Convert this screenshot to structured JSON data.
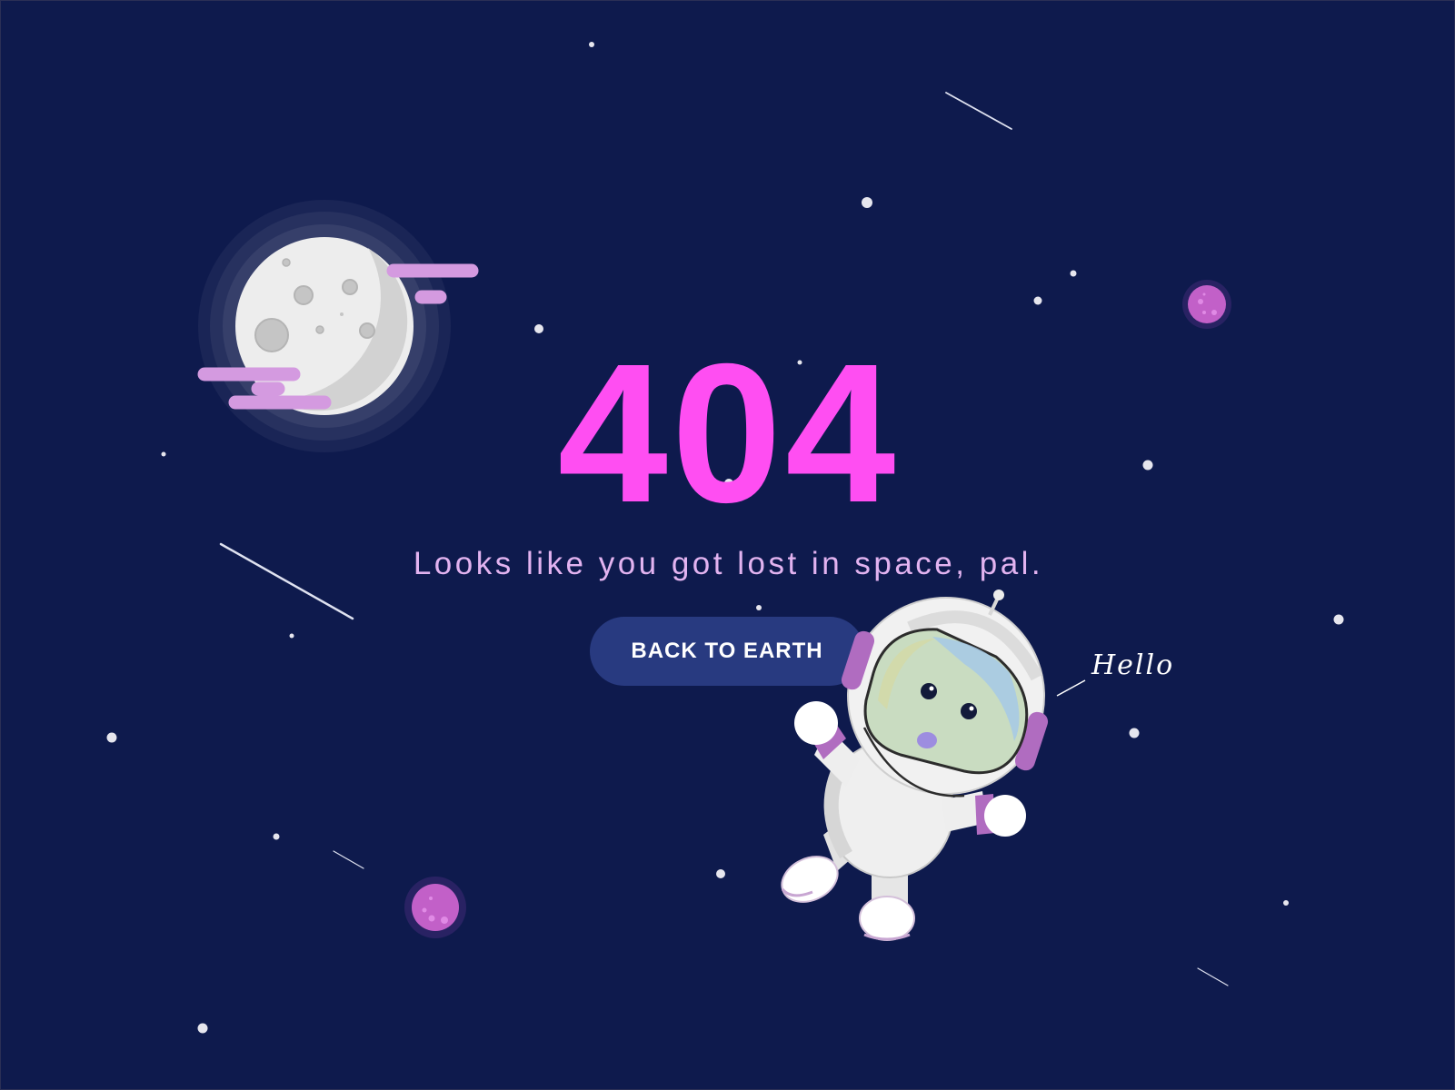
{
  "page": {
    "error_code": "404",
    "message": "Looks like you got lost in space, pal.",
    "back_button_label": "BACK TO EARTH",
    "astronaut_greeting": "Hello"
  },
  "colors": {
    "background": "#0e1a4d",
    "error_code": "#ff4ef2",
    "message": "#e2b3f0",
    "button_bg": "#283a80",
    "cloud": "#d49ae0",
    "planet": "#c260c8"
  },
  "icons": {
    "moon": "moon-icon",
    "astronaut": "astronaut-icon",
    "planet": "planet-icon",
    "star": "star-icon",
    "shooting_star": "shooting-star-icon"
  }
}
